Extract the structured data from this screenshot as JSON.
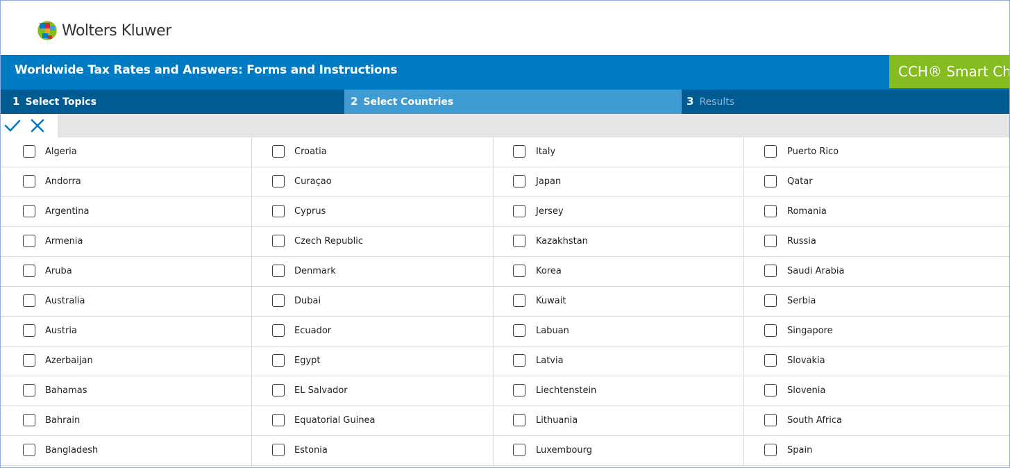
{
  "header": {
    "brand_name": "Wolters Kluwer"
  },
  "title_bar": {
    "title": "Worldwide Tax Rates and Answers: Forms and Instructions",
    "product": "CCH® Smart Charts"
  },
  "steps": [
    {
      "number": "1",
      "label": "Select Topics"
    },
    {
      "number": "2",
      "label": "Select Countries"
    },
    {
      "number": "3",
      "label": "Results"
    }
  ],
  "toolbar": {
    "select_all_icon": "check-icon",
    "clear_icon": "close-icon"
  },
  "colors": {
    "primary_blue": "#007ac3",
    "step_bar": "#005b92",
    "active_step": "#409bd2",
    "badge_green": "#85bc20"
  },
  "countries": {
    "col1": [
      "Algeria",
      "Andorra",
      "Argentina",
      "Armenia",
      "Aruba",
      "Australia",
      "Austria",
      "Azerbaijan",
      "Bahamas",
      "Bahrain",
      "Bangladesh"
    ],
    "col2": [
      "Croatia",
      "Curaçao",
      "Cyprus",
      "Czech Republic",
      "Denmark",
      "Dubai",
      "Ecuador",
      "Egypt",
      "EL Salvador",
      "Equatorial Guinea",
      "Estonia"
    ],
    "col3": [
      "Italy",
      "Japan",
      "Jersey",
      "Kazakhstan",
      "Korea",
      "Kuwait",
      "Labuan",
      "Latvia",
      "Liechtenstein",
      "Lithuania",
      "Luxembourg"
    ],
    "col4": [
      "Puerto Rico",
      "Qatar",
      "Romania",
      "Russia",
      "Saudi Arabia",
      "Serbia",
      "Singapore",
      "Slovakia",
      "Slovenia",
      "South Africa",
      "Spain"
    ]
  }
}
